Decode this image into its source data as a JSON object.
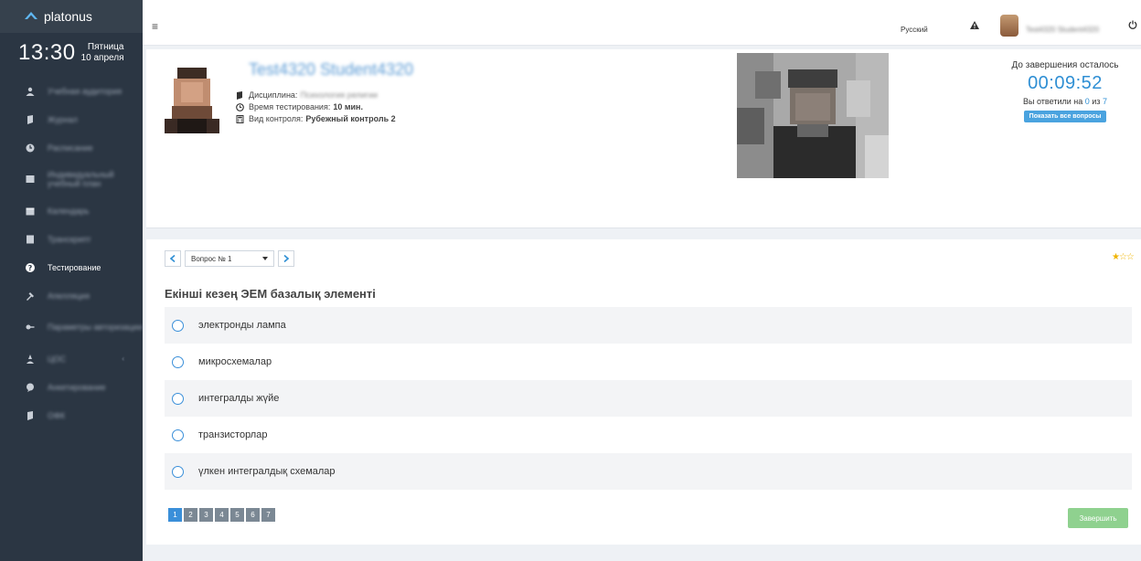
{
  "app": {
    "brand": "platonus"
  },
  "clock": {
    "time": "13:30",
    "weekday": "Пятница",
    "date": "10 апреля"
  },
  "sidebar": {
    "items": [
      {
        "label": "Учебная аудитория",
        "icon": "users-icon"
      },
      {
        "label": "Журнал",
        "icon": "book-icon"
      },
      {
        "label": "Расписание",
        "icon": "clock-icon"
      },
      {
        "label": "Индивидуальный учебный план",
        "icon": "list-icon"
      },
      {
        "label": "Календарь",
        "icon": "calendar-icon"
      },
      {
        "label": "Транскрипт",
        "icon": "document-icon"
      },
      {
        "label": "Тестирование",
        "icon": "question-icon",
        "active": true
      },
      {
        "label": "Апелляция",
        "icon": "gavel-icon"
      },
      {
        "label": "Параметры авторизации",
        "icon": "key-icon"
      },
      {
        "label": "ЦОС",
        "icon": "user-icon",
        "arrow": "‹"
      },
      {
        "label": "Анкетирование",
        "icon": "chat-icon"
      },
      {
        "label": "ОФК",
        "icon": "file-icon"
      }
    ]
  },
  "topbar": {
    "menu_icon": "≡",
    "language": "Русский",
    "user_name": "Test4320 Student4320",
    "power_icon": "power-icon"
  },
  "student": {
    "name": "Test4320 Student4320",
    "discipline_label": "Дисциплина:",
    "discipline_value": "Психология религии",
    "time_label": "Время тестирования:",
    "time_value": "10 мин.",
    "control_label": "Вид контроля:",
    "control_value": "Рубежный контроль 2"
  },
  "timer": {
    "label": "До завершения осталось",
    "value": "00:09:52",
    "answered_prefix": "Вы ответили на",
    "answered_count": "0",
    "answered_sep": "из",
    "answered_total": "7",
    "show_all_button": "Показать все вопросы"
  },
  "question": {
    "selector_label": "Вопрос № 1",
    "stars": "★☆☆",
    "title": "Екінші кезең ЭЕМ базалық элементі",
    "answers": [
      "электронды лампа",
      "микросхемалар",
      "интегралды жүйе",
      "транзисторлар",
      "үлкен интегралдық схемалар"
    ],
    "pages": [
      "1",
      "2",
      "3",
      "4",
      "5",
      "6",
      "7"
    ],
    "current_page": 1,
    "finish_button": "Завершить"
  },
  "colors": {
    "sidebar": "#2b3643",
    "accent": "#2f8fd4",
    "finish": "#8fd18f",
    "star": "#f0b400"
  }
}
